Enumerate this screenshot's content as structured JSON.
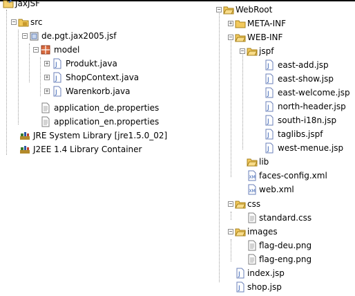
{
  "left_tree": {
    "project": "JaxJSF",
    "src": "src",
    "package": "de.pgt.jax2005.jsf",
    "model": "model",
    "files": [
      "Produkt.java",
      "ShopContext.java",
      "Warenkorb.java"
    ],
    "props": [
      "application_de.properties",
      "application_en.properties"
    ],
    "libs": [
      "JRE System Library [jre1.5.0_02]",
      "J2EE 1.4 Library Container"
    ]
  },
  "right_tree": {
    "webroot": "WebRoot",
    "metainf": "META-INF",
    "webinf": "WEB-INF",
    "jspf": "jspf",
    "jspf_files": [
      "east-add.jsp",
      "east-show.jsp",
      "east-welcome.jsp",
      "north-header.jsp",
      "south-i18n.jsp",
      "taglibs.jspf",
      "west-menue.jsp"
    ],
    "lib": "lib",
    "xml_files": [
      "faces-config.xml",
      "web.xml"
    ],
    "css": "css",
    "css_file": "standard.css",
    "images": "images",
    "image_files": [
      "flag-deu.png",
      "flag-eng.png"
    ],
    "root_files": [
      "index.jsp",
      "shop.jsp"
    ]
  }
}
